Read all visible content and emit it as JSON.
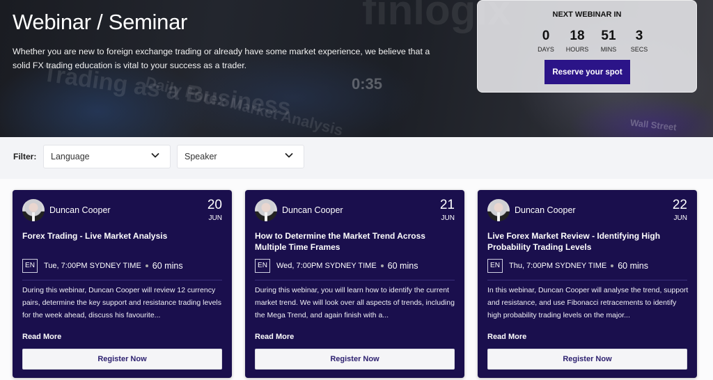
{
  "hero": {
    "title": "Webinar / Seminar",
    "description": "Whether you are new to foreign exchange trading or already have some market experience, we believe that a solid FX trading education is vital to your success as a trader.",
    "background_text": [
      "Trading as a Business",
      "Daily Forex Market Analysis",
      "0:35",
      "finlogix",
      "Wall Street"
    ]
  },
  "countdown": {
    "title": "NEXT WEBINAR IN",
    "units": [
      {
        "value": "0",
        "label": "DAYS"
      },
      {
        "value": "18",
        "label": "HOURS"
      },
      {
        "value": "51",
        "label": "MINS"
      },
      {
        "value": "3",
        "label": "SECS"
      }
    ],
    "button_label": "Reserve your spot",
    "button_color": "#2b1488"
  },
  "filter": {
    "label": "Filter:",
    "language": {
      "value": "Language"
    },
    "speaker": {
      "value": "Speaker"
    }
  },
  "colors": {
    "card_bg": "#1a0f4d",
    "accent": "#2b1488"
  },
  "cards": [
    {
      "speaker": "Duncan Cooper",
      "day": "20",
      "month": "JUN",
      "title": "Forex Trading - Live Market Analysis",
      "language": "EN",
      "time": "Tue, 7:00PM SYDNEY TIME",
      "duration": "60 mins",
      "description": "During this webinar, Duncan Cooper will review 12 currency pairs, determine the key support and resistance trading levels for the week ahead, discuss his favourite...",
      "read_more": "Read More",
      "register": "Register Now"
    },
    {
      "speaker": "Duncan Cooper",
      "day": "21",
      "month": "JUN",
      "title": "How to Determine the Market Trend Across Multiple Time Frames",
      "language": "EN",
      "time": "Wed, 7:00PM SYDNEY TIME",
      "duration": "60 mins",
      "description": "During this webinar, you will learn how to identify the current market trend. We will look over all aspects of trends, including the Mega Trend, and again finish with a...",
      "read_more": "Read More",
      "register": "Register Now"
    },
    {
      "speaker": "Duncan Cooper",
      "day": "22",
      "month": "JUN",
      "title": "Live Forex Market Review - Identifying High Probability Trading Levels",
      "language": "EN",
      "time": "Thu, 7:00PM SYDNEY TIME",
      "duration": "60 mins",
      "description": "In this webinar, Duncan Cooper will analyse the trend, support and resistance, and use Fibonacci retracements to identify high probability trading levels on the major...",
      "read_more": "Read More",
      "register": "Register Now"
    }
  ]
}
